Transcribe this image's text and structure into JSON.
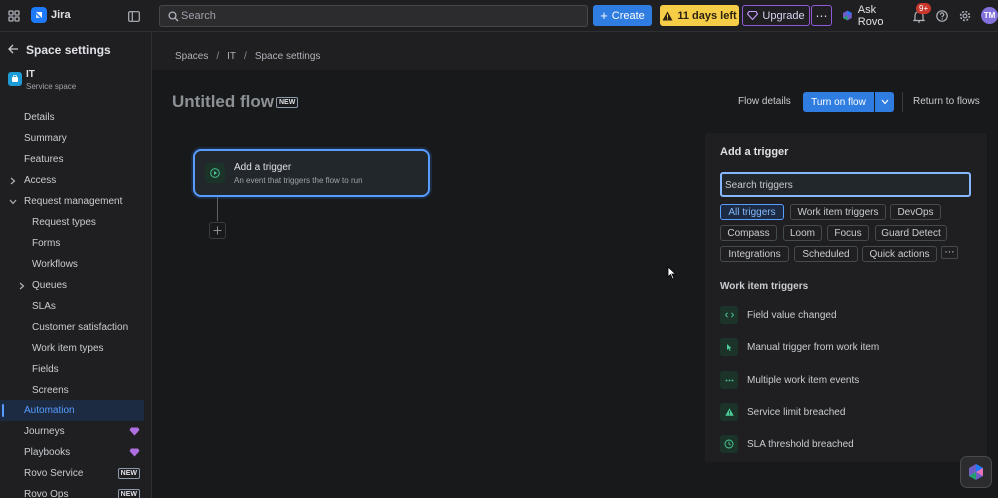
{
  "topbar": {
    "app_name": "Jira",
    "search_placeholder": "Search",
    "create_label": "Create",
    "trial_label": "11 days left",
    "upgrade_label": "Upgrade",
    "more_label": "⋯",
    "rovo_label": "Ask Rovo",
    "notification_count": "9+",
    "avatar_initials": "TM"
  },
  "sidebar": {
    "title": "Space settings",
    "space_name": "IT",
    "space_type": "Service space",
    "items": [
      {
        "label": "Details"
      },
      {
        "label": "Summary"
      },
      {
        "label": "Features"
      },
      {
        "label": "Access"
      },
      {
        "label": "Request management"
      },
      {
        "label": "Request types"
      },
      {
        "label": "Forms"
      },
      {
        "label": "Workflows"
      },
      {
        "label": "Queues"
      },
      {
        "label": "SLAs"
      },
      {
        "label": "Customer satisfaction"
      },
      {
        "label": "Work item types"
      },
      {
        "label": "Fields"
      },
      {
        "label": "Screens"
      },
      {
        "label": "Automation"
      },
      {
        "label": "Journeys"
      },
      {
        "label": "Playbooks"
      },
      {
        "label": "Rovo Service",
        "pill": "NEW"
      },
      {
        "label": "Rovo Ops",
        "pill": "NEW"
      }
    ]
  },
  "breadcrumb": [
    "Spaces",
    "IT",
    "Space settings"
  ],
  "flow": {
    "title": "Untitled flow",
    "title_pill": "NEW",
    "flow_details_label": "Flow details",
    "turn_on_label": "Turn on flow",
    "return_label": "Return to flows",
    "trigger_card_title": "Add a trigger",
    "trigger_card_subtitle": "An event that triggers the flow to run"
  },
  "panel": {
    "title": "Add a trigger",
    "search_placeholder": "Search triggers",
    "chips": [
      {
        "label": "All triggers",
        "selected": true
      },
      {
        "label": "Work item triggers"
      },
      {
        "label": "DevOps"
      },
      {
        "label": "Compass"
      },
      {
        "label": "Loom"
      },
      {
        "label": "Focus"
      },
      {
        "label": "Guard Detect"
      },
      {
        "label": "Integrations"
      },
      {
        "label": "Scheduled"
      },
      {
        "label": "Quick actions"
      }
    ],
    "more_chip": "⋯",
    "section_title": "Work item triggers",
    "triggers": [
      {
        "label": "Field value changed",
        "icon": "code-icon"
      },
      {
        "label": "Manual trigger from work item",
        "icon": "pointer-icon"
      },
      {
        "label": "Multiple work item events",
        "icon": "dots-icon"
      },
      {
        "label": "Service limit breached",
        "icon": "warning-icon"
      },
      {
        "label": "SLA threshold breached",
        "icon": "clock-icon"
      }
    ]
  },
  "colors": {
    "accent": "#2f7de1",
    "trial": "#f5cd47",
    "upgrade_border": "#8f5ad6",
    "trigger_icon": "#4bce97"
  }
}
